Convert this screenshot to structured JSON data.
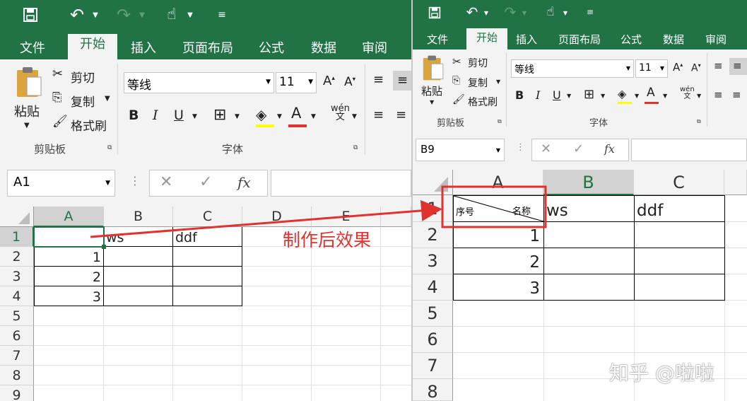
{
  "left": {
    "tabs": [
      "文件",
      "开始",
      "插入",
      "页面布局",
      "公式",
      "数据",
      "审阅"
    ],
    "clipboard": {
      "paste": "粘贴",
      "cut": "剪切",
      "copy": "复制",
      "painter": "格式刷",
      "group": "剪贴板"
    },
    "font": {
      "name": "等线",
      "size": "11",
      "group": "字体"
    },
    "namebox": "A1",
    "fx": "fx",
    "columns": [
      "A",
      "B",
      "C",
      "D",
      "E"
    ],
    "rows": [
      "1",
      "2",
      "3",
      "4",
      "5",
      "6",
      "7",
      "8",
      "9"
    ],
    "cells": {
      "B1": "ws",
      "C1": "ddf",
      "A2": "1",
      "A3": "2",
      "A4": "3"
    }
  },
  "right": {
    "tabs": [
      "文件",
      "开始",
      "插入",
      "页面布局",
      "公式",
      "数据",
      "审阅"
    ],
    "clipboard": {
      "paste": "粘贴",
      "cut": "剪切",
      "copy": "复制",
      "painter": "格式刷",
      "group": "剪贴板"
    },
    "font": {
      "name": "等线",
      "size": "11",
      "group": "字体"
    },
    "namebox": "B9",
    "fx": "fx",
    "columns": [
      "A",
      "B",
      "C"
    ],
    "rows": [
      "1",
      "2",
      "3",
      "4",
      "5",
      "6",
      "7",
      "8"
    ],
    "cells": {
      "A1_left": "序号",
      "A1_right": "名称",
      "B1": "ws",
      "C1": "ddf",
      "A2": "1",
      "A3": "2",
      "A4": "3"
    }
  },
  "annotation": "制作后效果",
  "watermark": "知乎 @啦啦",
  "colors": {
    "excel_green": "#217346",
    "arrow_red": "#e0322f"
  }
}
